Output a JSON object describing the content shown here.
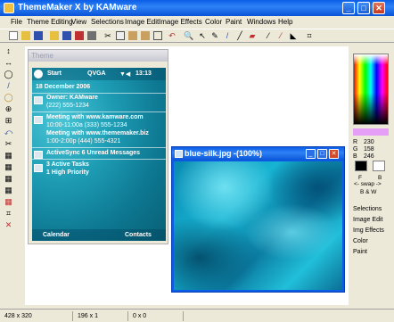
{
  "window": {
    "title": "ThemeMaker X by KAMware"
  },
  "title_buttons": {
    "minimize": "_",
    "maximize": "□",
    "close": "✕"
  },
  "menu": [
    "File",
    "Theme Editing",
    "View",
    "Selections",
    "Image Edit",
    "Image Effects",
    "Color",
    "Paint",
    "Windows",
    "Help"
  ],
  "toolbar": [
    "new",
    "open",
    "save",
    "open2",
    "save-as",
    "print",
    "cut",
    "copy",
    "paste",
    "paste2",
    "undo",
    "zoom",
    "select",
    "pencil",
    "brush",
    "line",
    "eraser",
    "eyedropper",
    "fill",
    "picker",
    "crop"
  ],
  "left_tools": [
    "↕",
    "↔",
    "◯",
    "/",
    "◯",
    "⊕",
    "⊞",
    "⤺",
    "✂",
    "▦",
    "▦",
    "▦",
    "▦",
    "▦",
    "⌗",
    "✕"
  ],
  "theme_window": {
    "title": "Theme",
    "start": "Start",
    "qvga": "QVGA",
    "time": "13:13",
    "date": "18 December 2006",
    "owner": "Owner: KAMware",
    "owner_phone": "(222) 555-1234",
    "meeting1": "Meeting with www.kamware.com",
    "meeting1_time": "10:00-11:00a (333) 555-1234",
    "meeting2": "Meeting with www.thememaker.biz",
    "meeting2_time": "1:00-2:00p (444) 555-4321",
    "activesync": "ActiveSync 6 Unread Messages",
    "tasks": "3 Active Tasks",
    "priority": "1 High Priority",
    "calendar": "Calendar",
    "contacts": "Contacts"
  },
  "image_window": {
    "title": "blue-silk.jpg -(100%)",
    "min": "_",
    "max": "□",
    "close": "✕"
  },
  "right_panel": {
    "selected_color": "#e69ff6",
    "r_label": "R",
    "g_label": "G",
    "b_label": "B",
    "r": "230",
    "g": "158",
    "b": "246",
    "f": "F",
    "b_bg": "B",
    "swap": "<- swap ->",
    "bw": "B & W",
    "links": [
      "Selections",
      "Image Edit",
      "Img Effects",
      "Color",
      "Paint"
    ]
  },
  "status": [
    "428 x 320",
    "196 x 1",
    "0 x 0"
  ]
}
